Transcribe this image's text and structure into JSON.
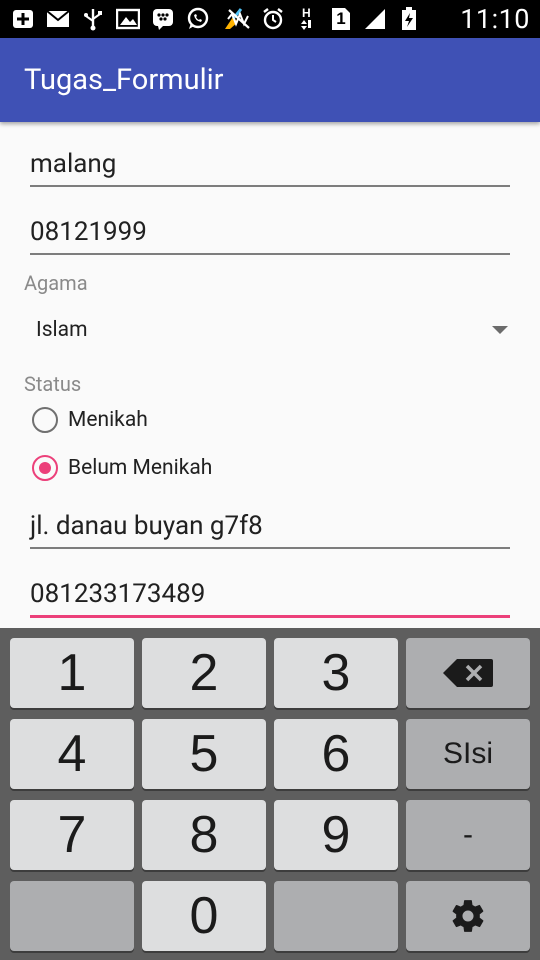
{
  "status_bar": {
    "time": "11:10",
    "sim_label": "1",
    "icons_left": [
      "add-icon",
      "email-icon",
      "usb-icon",
      "image-icon",
      "bbm-icon",
      "whatsapp-icon",
      "cleaner-icon"
    ],
    "icons_right": [
      "mute-icon",
      "alarm-icon",
      "hspa-icon",
      "sim-icon",
      "signal-icon",
      "battery-icon"
    ]
  },
  "app_bar": {
    "title": "Tugas_Formulir"
  },
  "form": {
    "kota": "malang",
    "kode": "08121999",
    "agama_label": "Agama",
    "agama_value": "Islam",
    "status_label": "Status",
    "status_options": [
      {
        "label": "Menikah",
        "checked": false
      },
      {
        "label": "Belum Menikah",
        "checked": true
      }
    ],
    "alamat": "jl. danau buyan g7f8",
    "telepon": "081233173489"
  },
  "keyboard": {
    "keys": [
      "1",
      "2",
      "3",
      "4",
      "5",
      "6",
      "7",
      "8",
      "9",
      "0"
    ],
    "fill_label": "SIsi",
    "dash_label": "-",
    "backspace_icon": "backspace-icon",
    "settings_icon": "gear-icon"
  },
  "colors": {
    "app_bar": "#3f51b5",
    "accent": "#ec407a",
    "keyboard_bg": "#5e5e5e",
    "key_bg": "#dddedf",
    "func_key_bg": "#adaeb0"
  }
}
